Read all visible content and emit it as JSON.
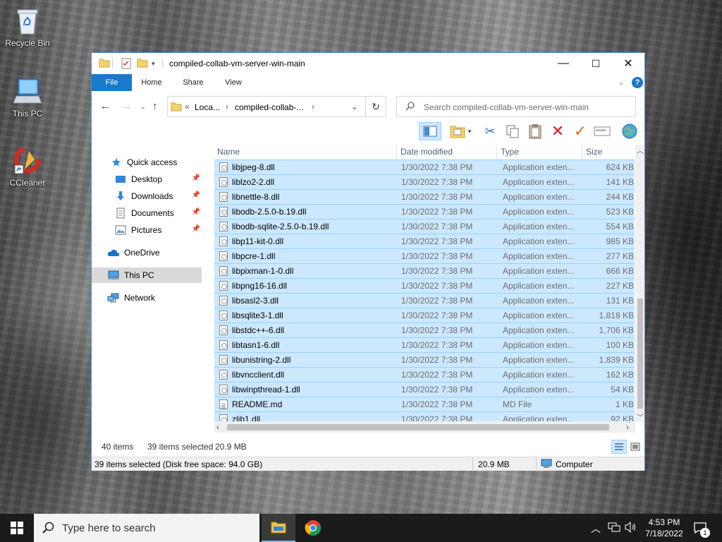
{
  "desktop": {
    "icons": [
      {
        "label": "Recycle Bin"
      },
      {
        "label": "This PC"
      },
      {
        "label": "CCleaner"
      }
    ]
  },
  "window": {
    "title": "compiled-collab-vm-server-win-main",
    "controls": {
      "minimize": "—",
      "maximize": "☐",
      "close": "✕"
    },
    "ribbon_tabs": [
      "File",
      "Home",
      "Share",
      "View"
    ],
    "address": {
      "segments": [
        "Loca...",
        "compiled-collab-..."
      ],
      "prefix": "«"
    },
    "search": {
      "placeholder": "Search compiled-collab-vm-server-win-main"
    },
    "accent": "#1979ca"
  },
  "navpane": {
    "items": [
      {
        "label": "Quick access",
        "icon": "star-icon",
        "pinned": false
      },
      {
        "label": "Desktop",
        "icon": "desktop-icon",
        "pinned": true
      },
      {
        "label": "Downloads",
        "icon": "download-icon",
        "pinned": true
      },
      {
        "label": "Documents",
        "icon": "document-icon",
        "pinned": true
      },
      {
        "label": "Pictures",
        "icon": "picture-icon",
        "pinned": true
      },
      {
        "label": "OneDrive",
        "icon": "cloud-icon",
        "pinned": false
      },
      {
        "label": "This PC",
        "icon": "computer-icon",
        "pinned": false,
        "selected": true
      },
      {
        "label": "Network",
        "icon": "network-icon",
        "pinned": false
      }
    ]
  },
  "filelist": {
    "columns": [
      "Name",
      "Date modified",
      "Type",
      "Size"
    ],
    "rows": [
      {
        "name": "libjpeg-8.dll",
        "date": "1/30/2022 7:38 PM",
        "type": "Application exten...",
        "size": "624 KB"
      },
      {
        "name": "liblzo2-2.dll",
        "date": "1/30/2022 7:38 PM",
        "type": "Application exten...",
        "size": "141 KB"
      },
      {
        "name": "libnettle-8.dll",
        "date": "1/30/2022 7:38 PM",
        "type": "Application exten...",
        "size": "244 KB"
      },
      {
        "name": "libodb-2.5.0-b.19.dll",
        "date": "1/30/2022 7:38 PM",
        "type": "Application exten...",
        "size": "523 KB"
      },
      {
        "name": "libodb-sqlite-2.5.0-b.19.dll",
        "date": "1/30/2022 7:38 PM",
        "type": "Application exten...",
        "size": "554 KB"
      },
      {
        "name": "libp11-kit-0.dll",
        "date": "1/30/2022 7:38 PM",
        "type": "Application exten...",
        "size": "985 KB"
      },
      {
        "name": "libpcre-1.dll",
        "date": "1/30/2022 7:38 PM",
        "type": "Application exten...",
        "size": "277 KB"
      },
      {
        "name": "libpixman-1-0.dll",
        "date": "1/30/2022 7:38 PM",
        "type": "Application exten...",
        "size": "666 KB"
      },
      {
        "name": "libpng16-16.dll",
        "date": "1/30/2022 7:38 PM",
        "type": "Application exten...",
        "size": "227 KB"
      },
      {
        "name": "libsasl2-3.dll",
        "date": "1/30/2022 7:38 PM",
        "type": "Application exten...",
        "size": "131 KB"
      },
      {
        "name": "libsqlite3-1.dll",
        "date": "1/30/2022 7:38 PM",
        "type": "Application exten...",
        "size": "1,818 KB"
      },
      {
        "name": "libstdc++-6.dll",
        "date": "1/30/2022 7:38 PM",
        "type": "Application exten...",
        "size": "1,706 KB"
      },
      {
        "name": "libtasn1-6.dll",
        "date": "1/30/2022 7:38 PM",
        "type": "Application exten...",
        "size": "100 KB"
      },
      {
        "name": "libunistring-2.dll",
        "date": "1/30/2022 7:38 PM",
        "type": "Application exten...",
        "size": "1,839 KB"
      },
      {
        "name": "libvncclient.dll",
        "date": "1/30/2022 7:38 PM",
        "type": "Application exten...",
        "size": "162 KB"
      },
      {
        "name": "libwinpthread-1.dll",
        "date": "1/30/2022 7:38 PM",
        "type": "Application exten...",
        "size": "54 KB"
      },
      {
        "name": "README.md",
        "date": "1/30/2022 7:38 PM",
        "type": "MD File",
        "size": "1 KB"
      },
      {
        "name": "zlib1.dll",
        "date": "1/30/2022 7:38 PM",
        "type": "Application exten...",
        "size": "92 KB"
      }
    ]
  },
  "infobar": {
    "item_count": "40 items",
    "selected": "39 items selected",
    "selected_size": "20.9 MB"
  },
  "statusbar": {
    "left": "39 items selected (Disk free space: 94.0 GB)",
    "size": "20.9 MB",
    "location": "Computer"
  },
  "taskbar": {
    "search_placeholder": "Type here to search",
    "time": "4:53 PM",
    "date": "7/18/2022",
    "notification_count": "1"
  }
}
